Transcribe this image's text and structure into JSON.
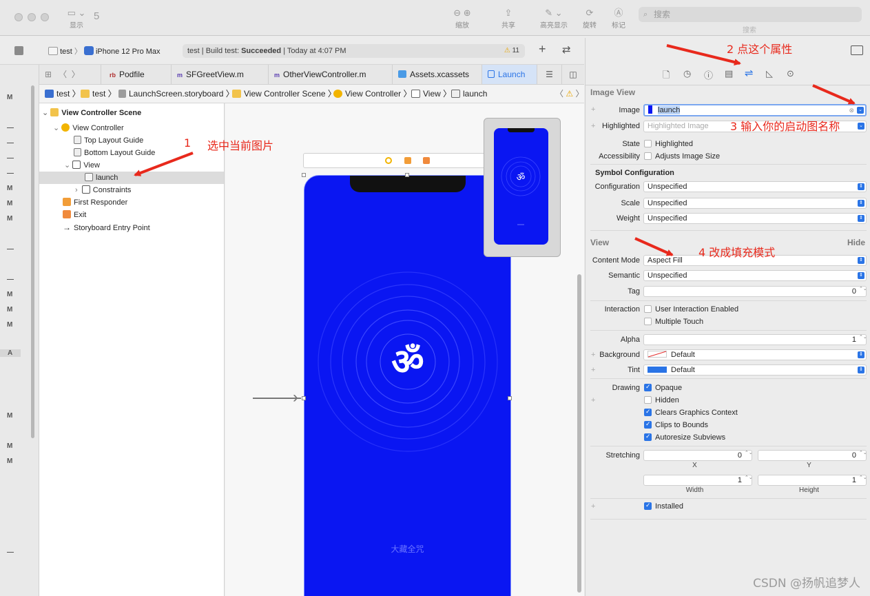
{
  "toolbar": {
    "nav_count": "5",
    "show_label": "显示",
    "zoom_label": "缩放",
    "share_label": "共享",
    "highlight_label": "高亮显示",
    "rotate_label": "旋转",
    "mark_label": "标记",
    "search_placeholder": "搜索",
    "search_caption": "搜索"
  },
  "scheme": {
    "project": "test",
    "device": "iPhone 12 Pro Max",
    "status_prefix": "test | Build test: ",
    "status_result": "Succeeded",
    "status_time": " | Today at 4:07 PM",
    "warning_count": "11"
  },
  "tabs": [
    {
      "prefix": "rb",
      "label": "Podfile"
    },
    {
      "prefix": "m",
      "label": "SFGreetView.m"
    },
    {
      "prefix": "m",
      "label": "OtherViewController.m"
    },
    {
      "prefix": "",
      "label": "Assets.xcassets"
    },
    {
      "prefix": "",
      "label": "Launch"
    }
  ],
  "breadcrumb": [
    "test",
    "test",
    "LaunchScreen.storyboard",
    "View Controller Scene",
    "View Controller",
    "View",
    "launch"
  ],
  "outline": {
    "scene": "View Controller Scene",
    "view_controller": "View Controller",
    "top_guide": "Top Layout Guide",
    "bottom_guide": "Bottom Layout Guide",
    "view": "View",
    "launch": "launch",
    "constraints": "Constraints",
    "first_responder": "First Responder",
    "exit": "Exit",
    "entry_point": "Storyboard Entry Point"
  },
  "left_strip": [
    "M",
    "—",
    "—",
    "—",
    "—",
    "M",
    "M",
    "M",
    "—",
    "—",
    "M",
    "M",
    "M",
    "A",
    "M",
    "M",
    "M",
    "—"
  ],
  "canvas": {
    "launch_caption": "大藏全咒"
  },
  "inspector": {
    "image_view_header": "Image View",
    "image_label": "Image",
    "image_value": "launch",
    "highlighted_label": "Highlighted",
    "highlighted_placeholder": "Highlighted Image",
    "state_label": "State",
    "state_highlighted": "Highlighted",
    "accessibility_label": "Accessibility",
    "adjusts_image_size": "Adjusts Image Size",
    "symbol_config_header": "Symbol Configuration",
    "configuration_label": "Configuration",
    "configuration_value": "Unspecified",
    "scale_label": "Scale",
    "scale_value": "Unspecified",
    "weight_label": "Weight",
    "weight_value": "Unspecified",
    "view_header": "View",
    "hide_label": "Hide",
    "content_mode_label": "Content Mode",
    "content_mode_value": "Aspect Fill",
    "semantic_label": "Semantic",
    "semantic_value": "Unspecified",
    "tag_label": "Tag",
    "tag_value": "0",
    "interaction_label": "Interaction",
    "user_interaction": "User Interaction Enabled",
    "multiple_touch": "Multiple Touch",
    "alpha_label": "Alpha",
    "alpha_value": "1",
    "background_label": "Background",
    "background_value": "Default",
    "tint_label": "Tint",
    "tint_value": "Default",
    "drawing_label": "Drawing",
    "opaque": "Opaque",
    "hidden": "Hidden",
    "clears_graphics": "Clears Graphics Context",
    "clips_to_bounds": "Clips to Bounds",
    "autoresize_subviews": "Autoresize Subviews",
    "stretching_label": "Stretching",
    "stretch_x": "0",
    "stretch_y": "0",
    "stretch_w": "1",
    "stretch_h": "1",
    "x_caption": "X",
    "y_caption": "Y",
    "width_caption": "Width",
    "height_caption": "Height",
    "installed": "Installed"
  },
  "annotations": {
    "step1_num": "1",
    "step1": "选中当前图片",
    "step2": "2  点这个属性",
    "step3": "3 输入你的启动图名称",
    "step4": "4 改成填充模式"
  },
  "watermark": "CSDN @扬帆追梦人",
  "colors": {
    "launch_blue": "#0a16f2",
    "accent": "#2a74e6",
    "annotation_red": "#e8291c"
  }
}
